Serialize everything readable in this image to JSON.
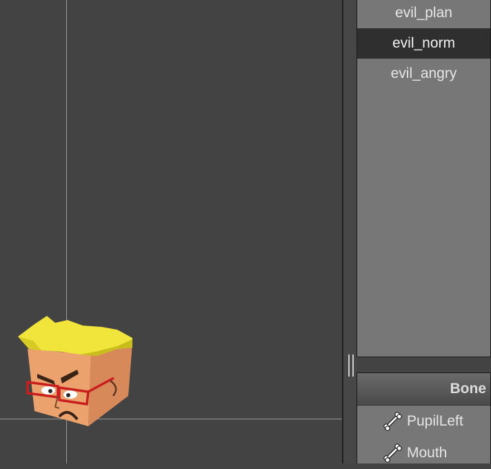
{
  "animations": {
    "items": [
      {
        "label": "evil_plan",
        "selected": false
      },
      {
        "label": "evil_norm",
        "selected": true
      },
      {
        "label": "evil_angry",
        "selected": false
      }
    ]
  },
  "bone_panel": {
    "header": "Bone",
    "items": [
      {
        "label": "PupilLeft",
        "icon": "bone-icon"
      },
      {
        "label": "Mouth",
        "icon": "bone-icon"
      }
    ]
  },
  "viewport": {
    "character": "angry-character-head"
  },
  "colors": {
    "background": "#434343",
    "panel": "#777777",
    "selected_row": "#2f2f2f",
    "guide_line": "#9a9a9a",
    "hair": "#f2e53a",
    "skin": "#e9a06a",
    "glasses": "#c81e1e"
  }
}
